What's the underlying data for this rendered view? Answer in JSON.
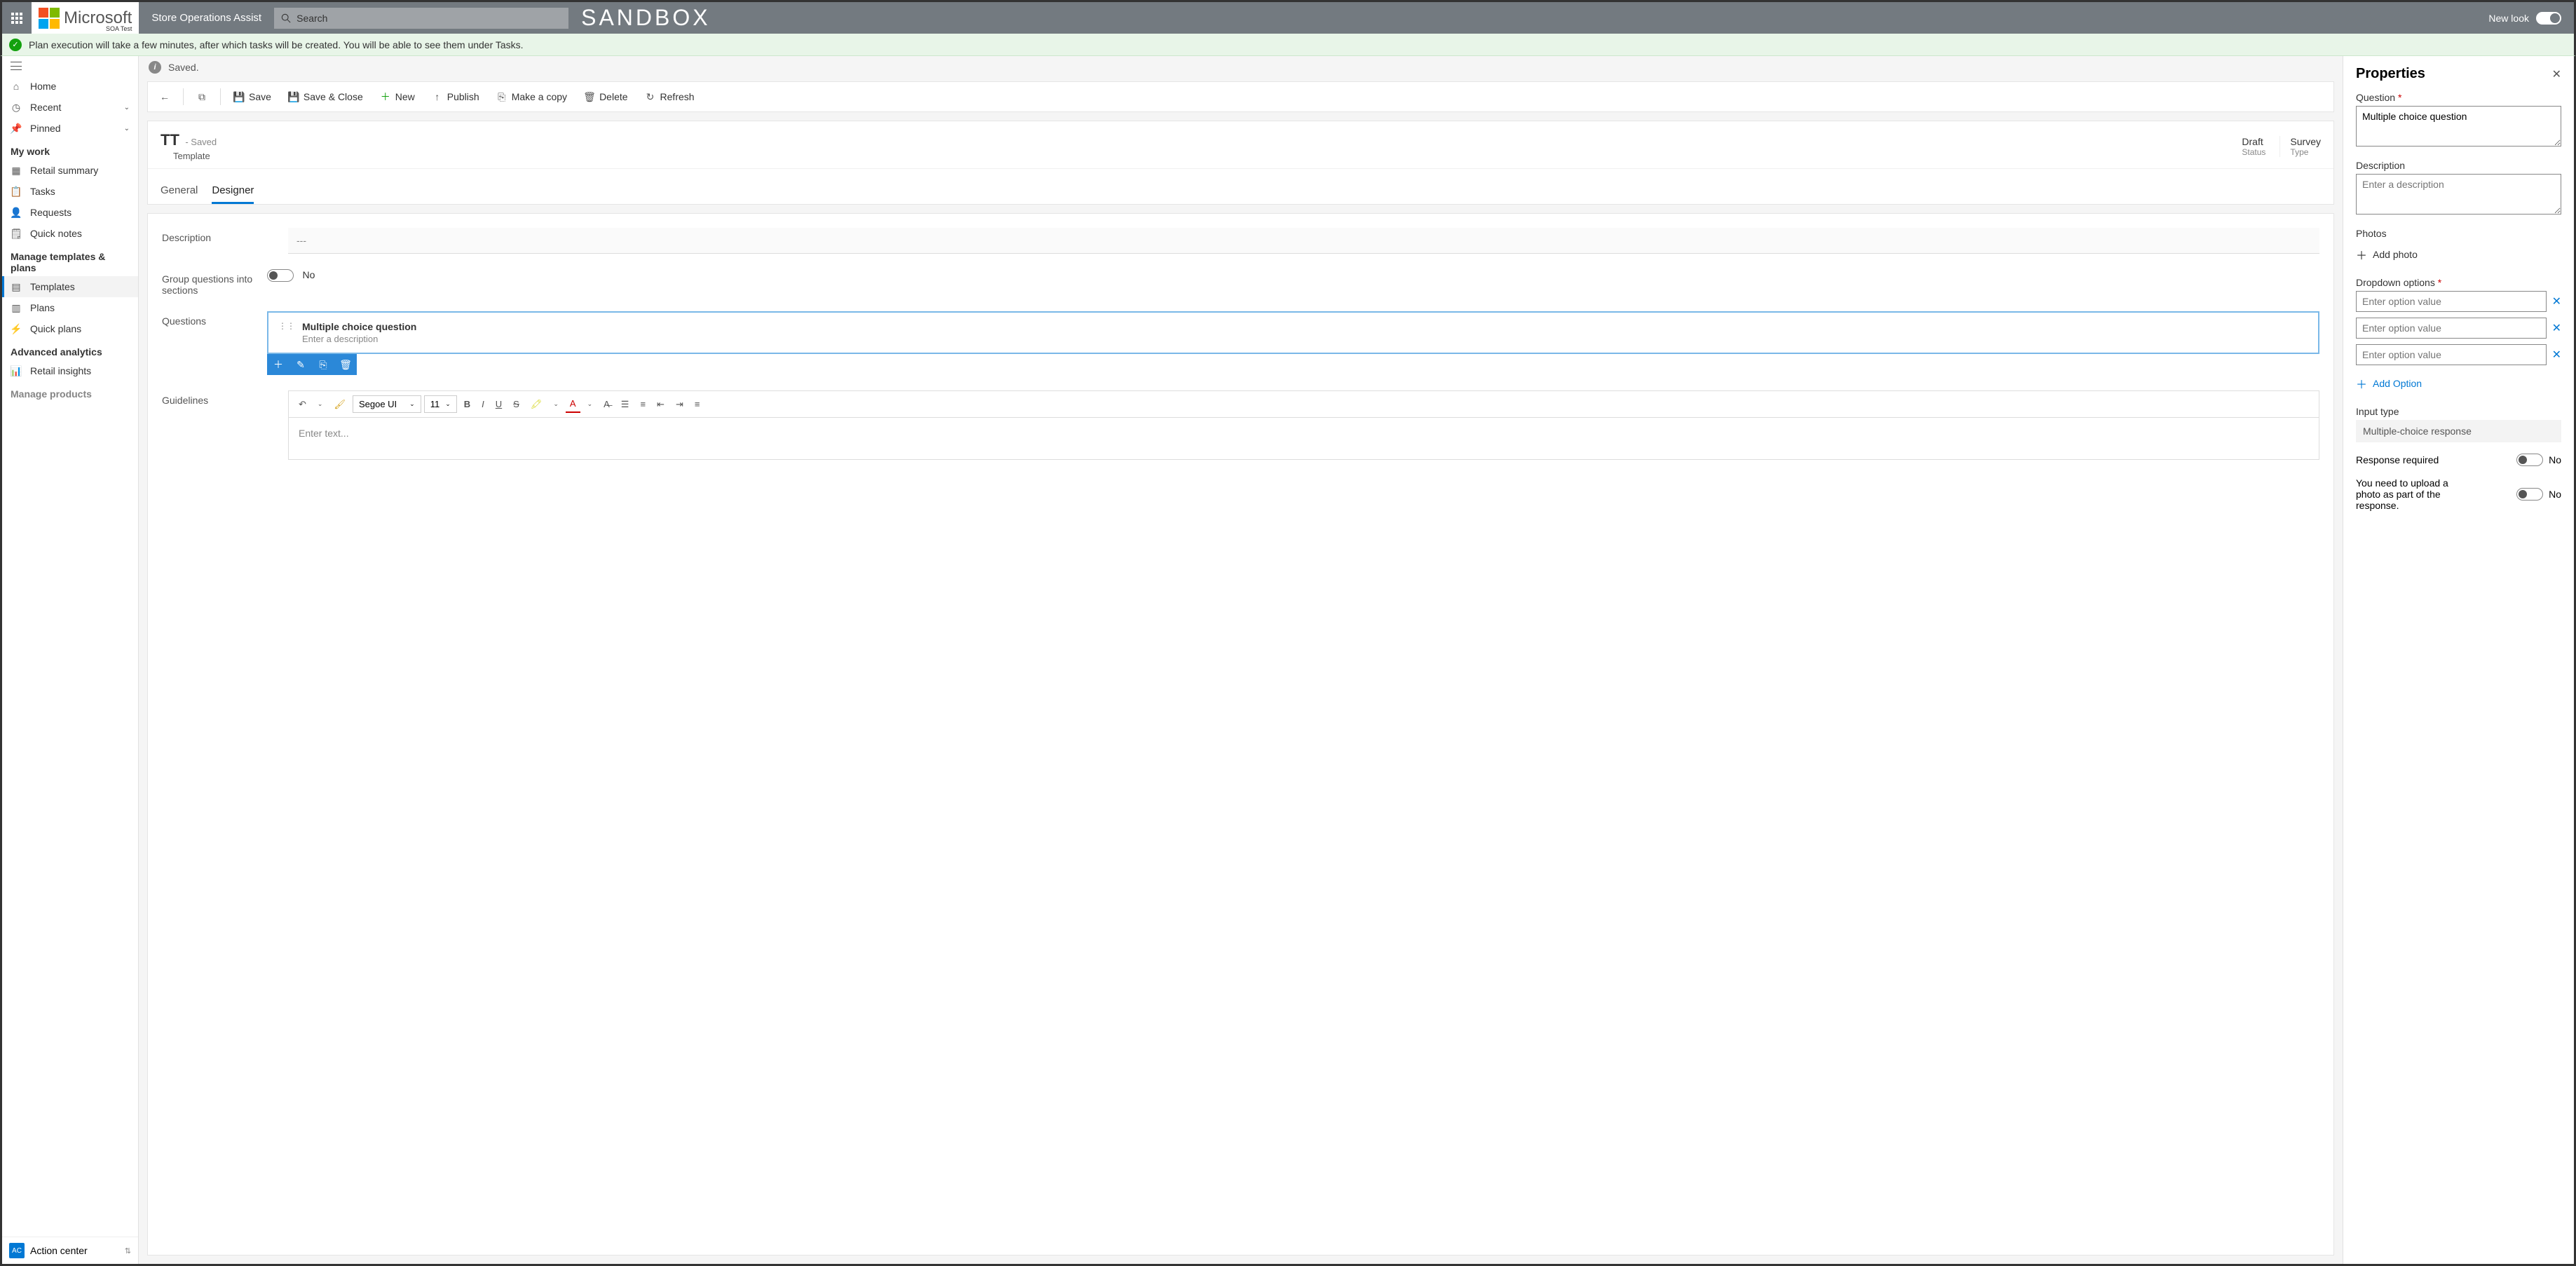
{
  "topbar": {
    "app_name": "Store Operations Assist",
    "sub_label": "SOA Test",
    "search_placeholder": "Search",
    "sandbox": "SANDBOX",
    "new_look": "New look"
  },
  "notification": {
    "text": "Plan execution will take a few minutes, after which tasks will be created. You will be able to see them under Tasks."
  },
  "saved_bar": {
    "text": "Saved."
  },
  "sidebar": {
    "home": "Home",
    "recent": "Recent",
    "pinned": "Pinned",
    "section_mywork": "My work",
    "retail_summary": "Retail summary",
    "tasks": "Tasks",
    "requests": "Requests",
    "quick_notes": "Quick notes",
    "section_templates": "Manage templates & plans",
    "templates": "Templates",
    "plans": "Plans",
    "quick_plans": "Quick plans",
    "section_analytics": "Advanced analytics",
    "retail_insights": "Retail insights",
    "section_products": "Manage products",
    "action_center": "Action center",
    "ac_badge": "AC"
  },
  "commands": {
    "save": "Save",
    "save_close": "Save & Close",
    "new": "New",
    "publish": "Publish",
    "copy": "Make a copy",
    "delete": "Delete",
    "refresh": "Refresh"
  },
  "record": {
    "title": "TT",
    "saved": "- Saved",
    "type": "Template",
    "status_val": "Draft",
    "status_lbl": "Status",
    "type_val": "Survey",
    "type_lbl": "Type",
    "tabs": {
      "general": "General",
      "designer": "Designer"
    }
  },
  "form": {
    "desc_label": "Description",
    "desc_placeholder": "---",
    "group_label": "Group questions into sections",
    "group_val": "No",
    "questions_label": "Questions",
    "question_title": "Multiple choice question",
    "question_desc": "Enter a description",
    "guidelines_label": "Guidelines",
    "rte_font": "Segoe UI",
    "rte_size": "11",
    "rte_placeholder": "Enter text..."
  },
  "props": {
    "title": "Properties",
    "question_label": "Question",
    "question_val": "Multiple choice question",
    "desc_label": "Description",
    "desc_placeholder": "Enter a description",
    "photos_label": "Photos",
    "add_photo": "Add photo",
    "dropdown_label": "Dropdown options",
    "option_placeholder": "Enter option value",
    "add_option": "Add Option",
    "input_type_label": "Input type",
    "input_type_val": "Multiple-choice response",
    "resp_req_label": "Response required",
    "resp_req_val": "No",
    "upload_label": "You need to upload a photo as part of the response.",
    "upload_val": "No"
  }
}
